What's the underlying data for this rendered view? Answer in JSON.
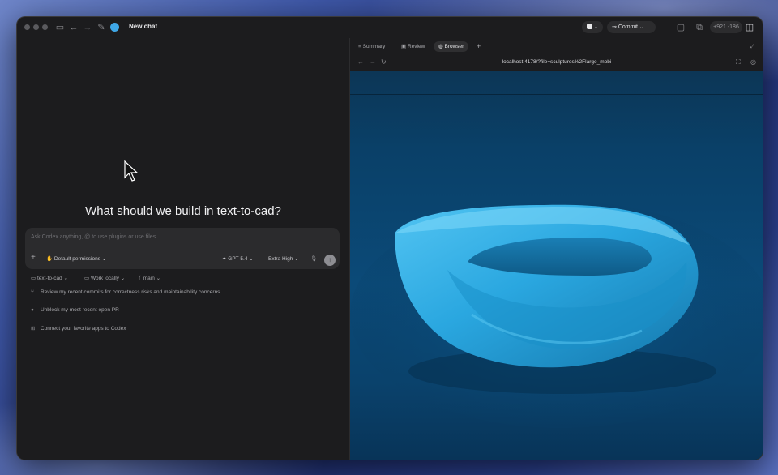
{
  "window": {
    "title": "New chat"
  },
  "toolbar": {
    "commit_label": "Commit",
    "diff_stat": "+921 -186"
  },
  "chat": {
    "headline": "What should we build in text-to-cad?",
    "composer": {
      "placeholder": "Ask Codex anything, @ to use plugins or use files",
      "permissions": "Default permissions",
      "model": "GPT-5.4",
      "reasoning": "Extra High"
    },
    "context": {
      "project": "text-to-cad",
      "location": "Work locally",
      "branch": "main"
    },
    "suggestions": [
      {
        "icon": "commit-icon",
        "label": "Review my recent commits for correctness risks and maintainability concerns"
      },
      {
        "icon": "github-icon",
        "label": "Unblock my most recent open PR"
      },
      {
        "icon": "apps-icon",
        "label": "Connect your favorite apps to Codex"
      }
    ]
  },
  "panel": {
    "tabs": [
      {
        "label": "Summary"
      },
      {
        "label": "Review"
      },
      {
        "label": "Browser",
        "active": true
      }
    ],
    "url": "localhost:4178/?file=sculptures%2Flarge_mobi"
  },
  "colors": {
    "accent": "#3fa7e6",
    "sculpture": "#2aa7e0",
    "background": "#0b4a78"
  }
}
